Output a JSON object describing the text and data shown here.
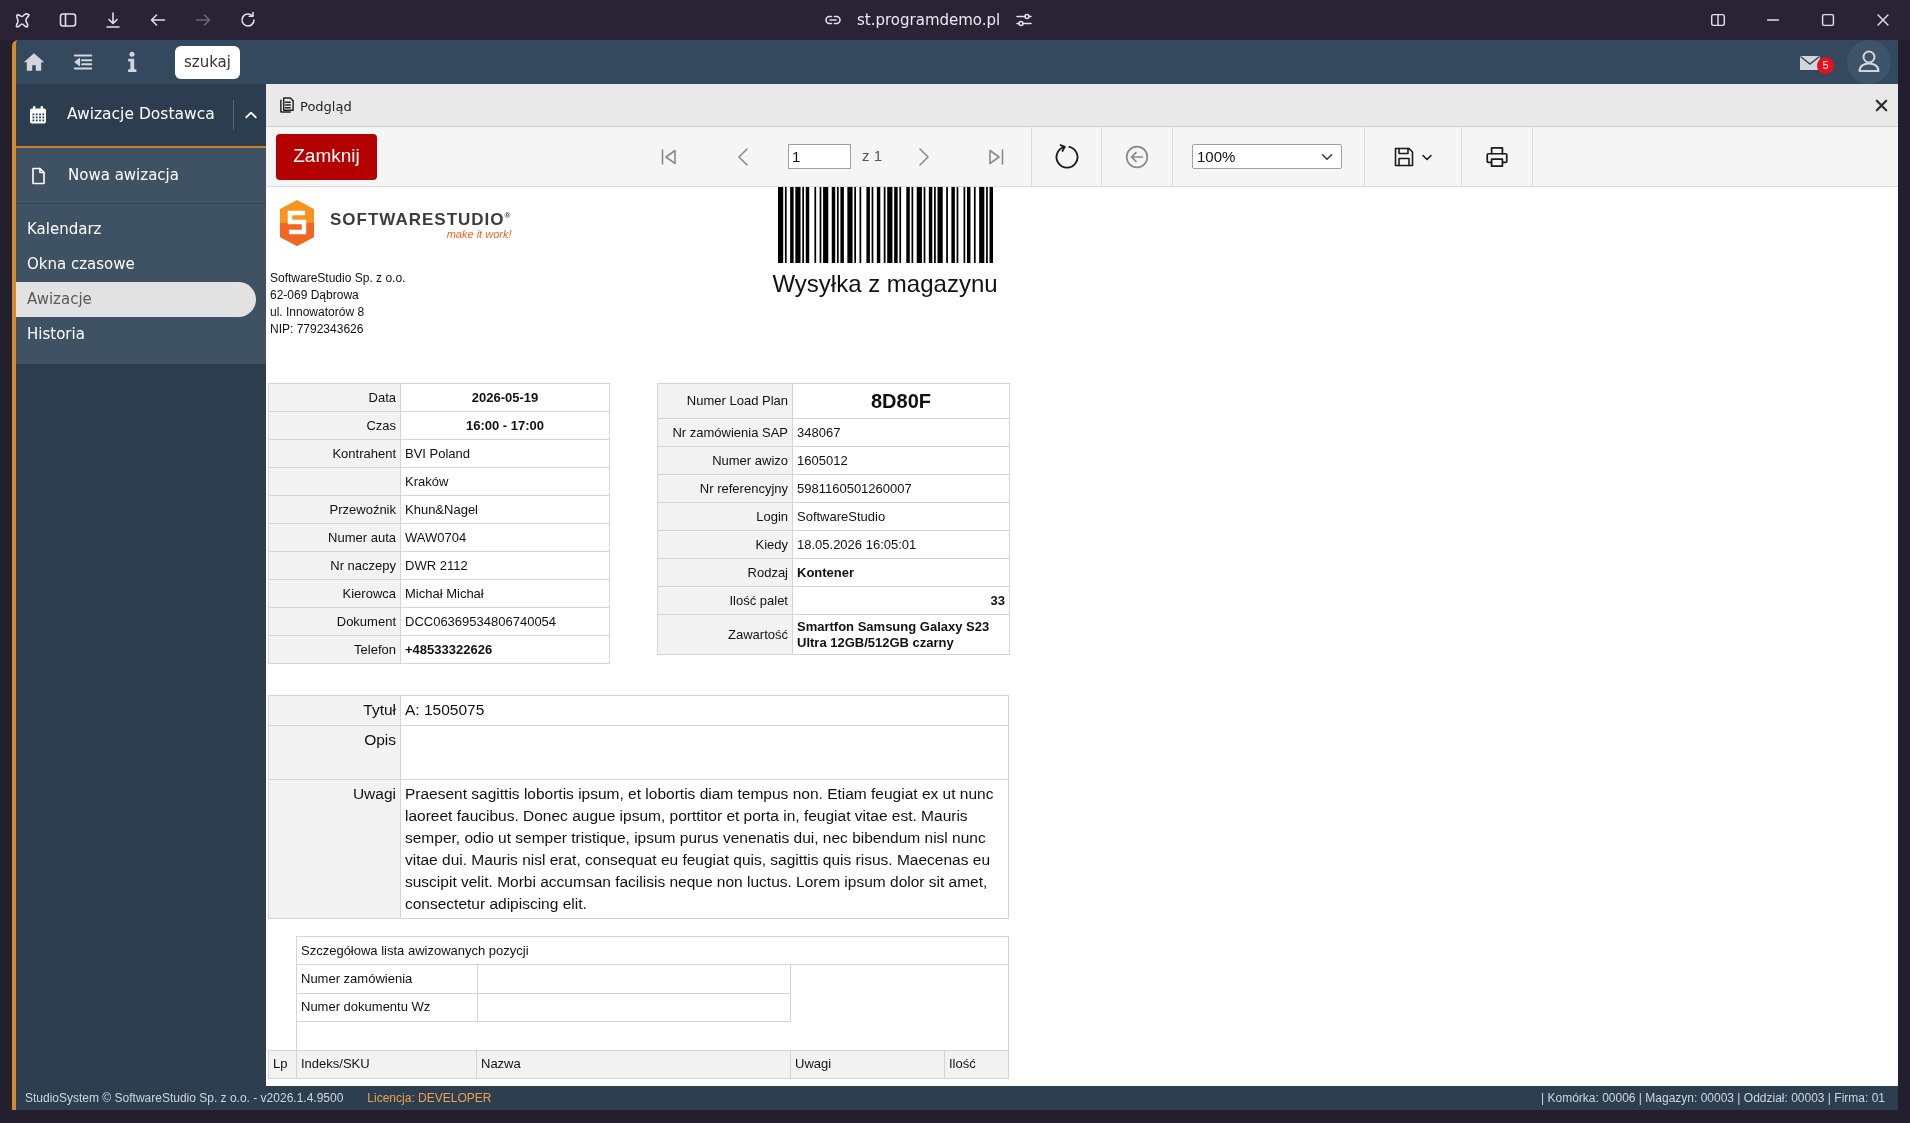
{
  "browser": {
    "url": "st.programdemo.pl",
    "buttons": [
      {
        "kind": "back",
        "disabled": false
      },
      {
        "kind": "forward",
        "disabled": true
      },
      {
        "kind": "reload",
        "disabled": false
      }
    ]
  },
  "app_header": {
    "search_button": "szukaj",
    "mail_count": "5"
  },
  "sidebar": {
    "module": {
      "label": "Awizacje Dostawca",
      "expanded": true
    },
    "action": "Nowa awizacja",
    "items": [
      {
        "label": "Kalendarz",
        "selected": false
      },
      {
        "label": "Okna czasowe",
        "selected": false
      },
      {
        "label": "Awizacje",
        "selected": true
      },
      {
        "label": "Historia",
        "selected": false
      }
    ]
  },
  "panel": {
    "title": "Podgląd"
  },
  "toolbar": {
    "close_button": "Zamknij",
    "items": [
      {
        "kind": "first",
        "disabled": true
      },
      {
        "kind": "previous",
        "disabled": true
      },
      {
        "kind": "page",
        "value": "1",
        "total": "z 1"
      },
      {
        "kind": "next",
        "disabled": true
      },
      {
        "kind": "last",
        "disabled": true
      },
      {
        "kind": "refresh",
        "disabled": false
      },
      {
        "kind": "back",
        "disabled": true
      },
      {
        "kind": "zoom",
        "value": "100%"
      },
      {
        "kind": "save",
        "disabled": false
      },
      {
        "kind": "print",
        "disabled": false
      }
    ]
  },
  "document": {
    "logo": {
      "name": "**SOFTWARE**STUDIO$^{®}$",
      "tagline": "make it work!"
    },
    "company_address": [
      "SoftwareStudio Sp. z o.o.",
      "62-069 Dąbrowa",
      "ul. Innowatorów 8",
      "NIP: 7792343626"
    ],
    "title": "Wysyłka z magazynu",
    "delivery_table": [
      {
        "label": "Data",
        "value": "2026-05-19",
        "kind": "centered"
      },
      {
        "label": "Czas",
        "value": "16:00 - 17:00",
        "kind": "centered"
      },
      {
        "label": "Kontrahent",
        "value": "BVI Poland",
        "kind": "plain"
      },
      {
        "value": "Kraków",
        "kind": "plain"
      },
      {
        "label": "Przewoźnik",
        "value": "Khun&Nagel",
        "kind": "plain"
      },
      {
        "label": "Numer auta",
        "value": "WAW0704",
        "kind": "plain"
      },
      {
        "label": "Nr naczepy",
        "value": "DWR 2112",
        "kind": "plain"
      },
      {
        "label": "Kierowca",
        "value": "Michał Michał",
        "kind": "plain"
      },
      {
        "label": "Dokument",
        "value": "DCC06369534806740054",
        "kind": "plain"
      },
      {
        "label": "Telefon",
        "value": "+48533322626",
        "kind": "strong"
      }
    ],
    "order_table": [
      {
        "label": "Numer Load Plan",
        "value": "8D80F",
        "kind": "headline"
      },
      {
        "label": "Nr zamówienia SAP",
        "value": "348067",
        "kind": "plain"
      },
      {
        "label": "Numer awizo",
        "value": "1605012",
        "kind": "plain"
      },
      {
        "label": "Nr referencyjny",
        "value": "5981160501260007",
        "kind": "plain"
      },
      {
        "label": "Login",
        "value": "SoftwareStudio",
        "kind": "plain"
      },
      {
        "label": "Kiedy",
        "value": "18.05.2026 16:05:01",
        "kind": "plain"
      },
      {
        "label": "Rodzaj",
        "value": "Kontener",
        "kind": "strong"
      },
      {
        "label": "Ilość palet",
        "value": "33",
        "kind": "number"
      },
      {
        "label": "Zawartość",
        "value": "Smartfon Samsung Galaxy S23 Ultra 12GB/512GB czarny",
        "kind": "strong"
      }
    ],
    "notes": [
      {
        "label": "Tytuł",
        "value": "A: 1505075"
      },
      {
        "label": "Opis"
      },
      {
        "label": "Uwagi",
        "value": "Praesent sagittis lobortis ipsum, et lobortis diam tempus non. Etiam feugiat ex ut nunc laoreet faucibus. Donec augue ipsum, porttitor et porta in, feugiat vitae est. Mauris semper, odio ut semper tristique, ipsum purus venenatis dui, nec bibendum nisl nunc vitae dui. Mauris nisl erat, consequat eu feugiat quis, sagittis quis risus. Maecenas eu suscipit velit. Morbi accumsan facilisis neque non luctus. Lorem ipsum dolor sit amet, consectetur adipiscing elit."
      }
    ],
    "positions": {
      "title": "Szczegółowa lista awizowanych pozycji",
      "fields": [
        {
          "label": "Numer zamówienia"
        },
        {
          "label": "Numer dokumentu Wz"
        }
      ],
      "columns": [
        "Lp",
        "Indeks/SKU",
        "Nazwa",
        "Uwagi",
        "Ilość"
      ]
    }
  },
  "status_bar": {
    "copyright": "StudioSystem © SoftwareStudio Sp. z o.o. - v2026.1.4.9500",
    "license": "Licencja: DEVELOPER",
    "location": "| Komórka: 00006 | Magazyn: 00003 | Oddział: 00003 | Firma: 01"
  }
}
